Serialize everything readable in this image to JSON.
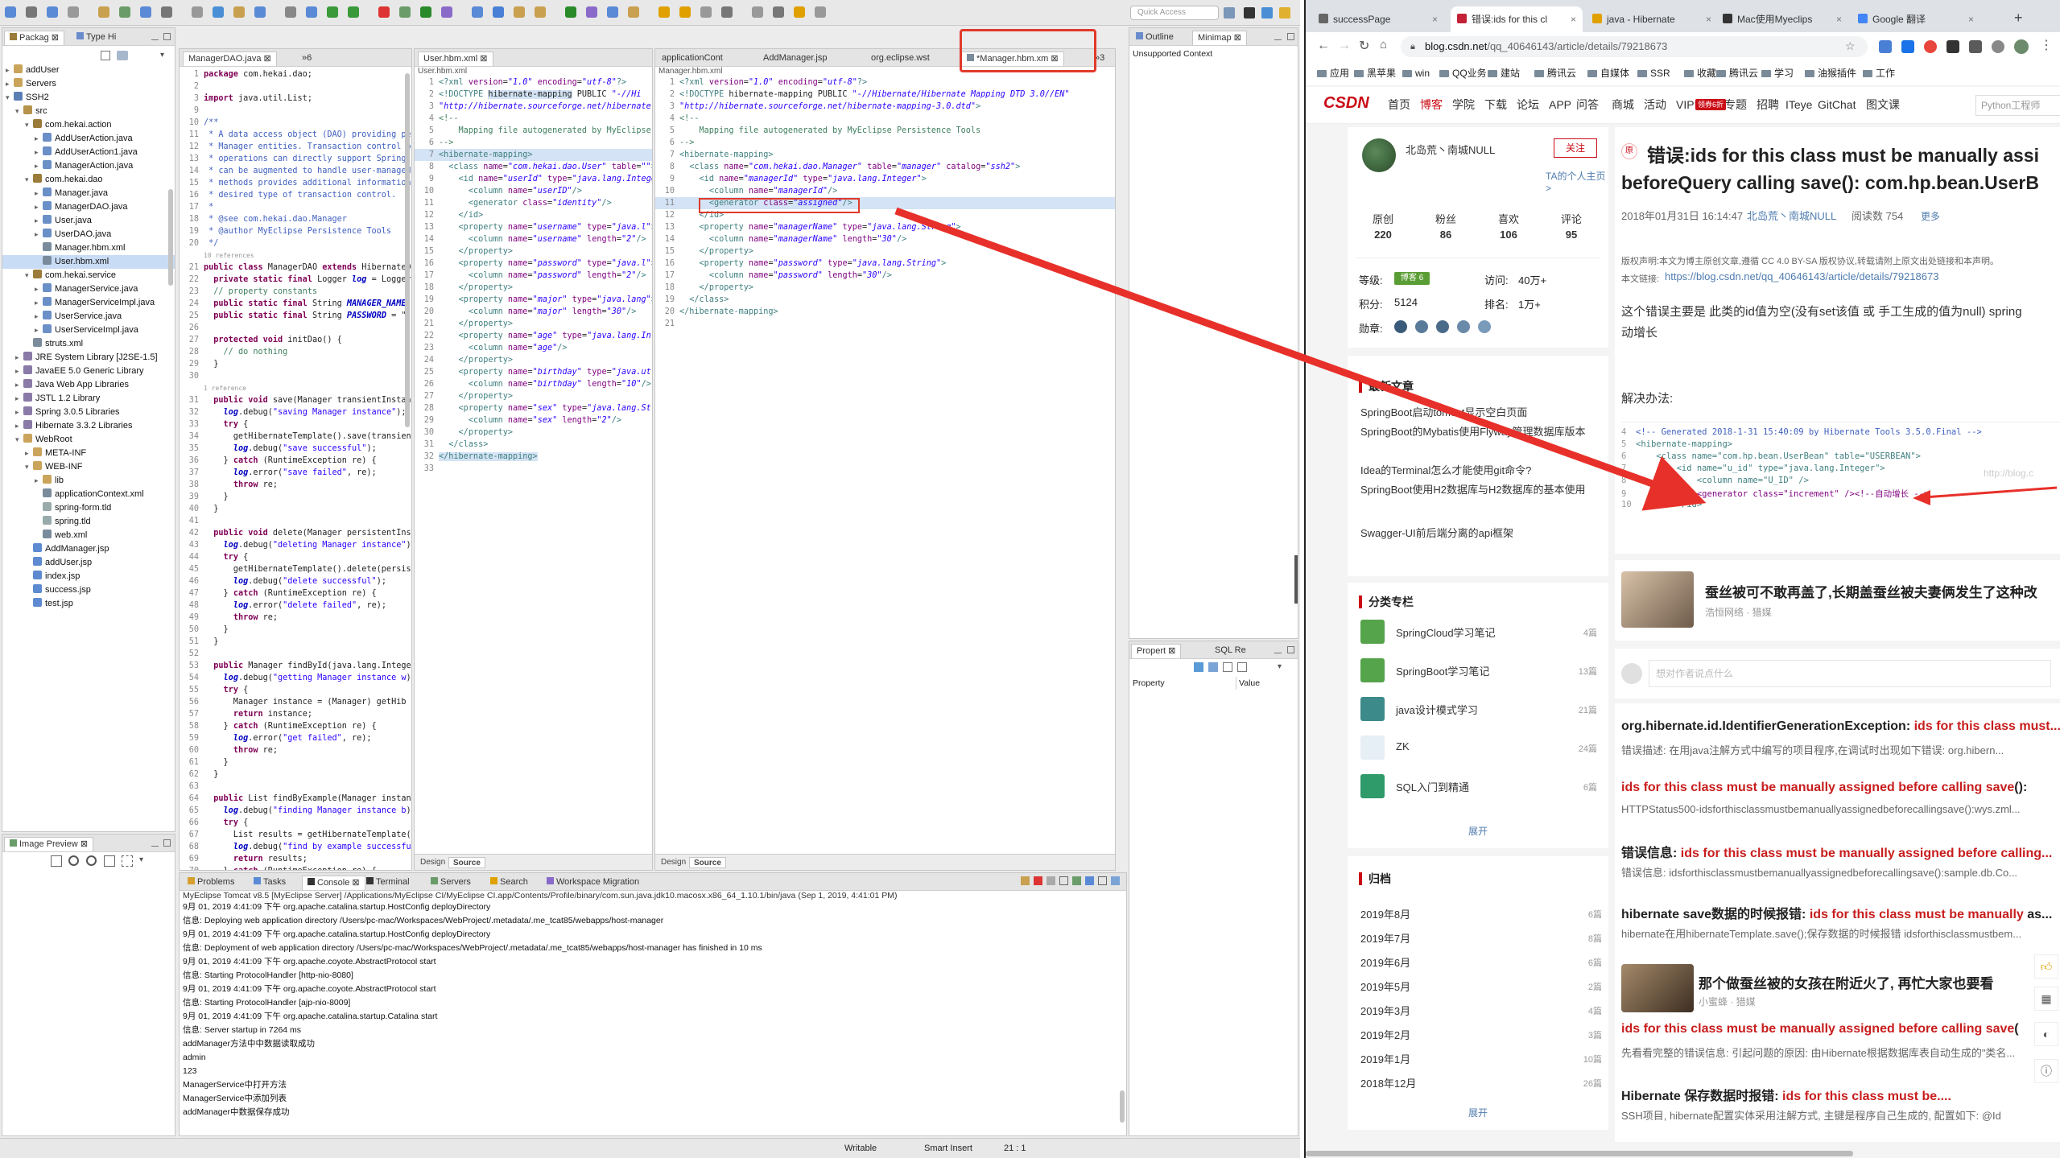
{
  "eclipse": {
    "toolbar": {
      "quick_access": "Quick Access"
    },
    "package_explorer": {
      "tabs": [
        "Packag",
        "Type Hi"
      ],
      "tree": [
        {
          "label": "addUser",
          "depth": 0,
          "tw": "▸",
          "icon": "folder",
          "color": "#caa45a"
        },
        {
          "label": "Servers",
          "depth": 0,
          "tw": "▸",
          "icon": "folder",
          "color": "#caa45a"
        },
        {
          "label": "SSH2",
          "depth": 0,
          "tw": "▾",
          "icon": "project",
          "color": "#5a7fb5"
        },
        {
          "label": "src",
          "depth": 1,
          "tw": "▾",
          "icon": "src",
          "color": "#b5934a"
        },
        {
          "label": "com.hekai.action",
          "depth": 2,
          "tw": "▾",
          "icon": "package",
          "color": "#9b7b3a"
        },
        {
          "label": "AddUserAction.java",
          "depth": 3,
          "tw": "▸",
          "icon": "java",
          "color": "#6b8fc7"
        },
        {
          "label": "AddUserAction1.java",
          "depth": 3,
          "tw": "▸",
          "icon": "java",
          "color": "#6b8fc7"
        },
        {
          "label": "ManagerAction.java",
          "depth": 3,
          "tw": "▸",
          "icon": "java",
          "color": "#6b8fc7"
        },
        {
          "label": "com.hekai.dao",
          "depth": 2,
          "tw": "▾",
          "icon": "package",
          "color": "#9b7b3a"
        },
        {
          "label": "Manager.java",
          "depth": 3,
          "tw": "▸",
          "icon": "java",
          "color": "#6b8fc7"
        },
        {
          "label": "ManagerDAO.java",
          "depth": 3,
          "tw": "▸",
          "icon": "java",
          "color": "#6b8fc7"
        },
        {
          "label": "User.java",
          "depth": 3,
          "tw": "▸",
          "icon": "java",
          "color": "#6b8fc7"
        },
        {
          "label": "UserDAO.java",
          "depth": 3,
          "tw": "▸",
          "icon": "java",
          "color": "#6b8fc7"
        },
        {
          "label": "Manager.hbm.xml",
          "depth": 3,
          "tw": "",
          "icon": "xml",
          "color": "#7a8b9c"
        },
        {
          "label": "User.hbm.xml",
          "depth": 3,
          "tw": "",
          "icon": "xml",
          "color": "#7a8b9c",
          "selected": true
        },
        {
          "label": "com.hekai.service",
          "depth": 2,
          "tw": "▾",
          "icon": "package",
          "color": "#9b7b3a"
        },
        {
          "label": "ManagerService.java",
          "depth": 3,
          "tw": "▸",
          "icon": "java",
          "color": "#6b8fc7"
        },
        {
          "label": "ManagerServiceImpl.java",
          "depth": 3,
          "tw": "▸",
          "icon": "java",
          "color": "#6b8fc7"
        },
        {
          "label": "UserService.java",
          "depth": 3,
          "tw": "▸",
          "icon": "java",
          "color": "#6b8fc7"
        },
        {
          "label": "UserServiceImpl.java",
          "depth": 3,
          "tw": "▸",
          "icon": "java",
          "color": "#6b8fc7"
        },
        {
          "label": "struts.xml",
          "depth": 2,
          "tw": "",
          "icon": "xml",
          "color": "#7a8b9c"
        },
        {
          "label": "JRE System Library [J2SE-1.5]",
          "depth": 1,
          "tw": "▸",
          "icon": "lib",
          "color": "#8a7aa8"
        },
        {
          "label": "JavaEE 5.0 Generic Library",
          "depth": 1,
          "tw": "▸",
          "icon": "lib",
          "color": "#8a7aa8"
        },
        {
          "label": "Java Web App Libraries",
          "depth": 1,
          "tw": "▸",
          "icon": "lib",
          "color": "#8a7aa8"
        },
        {
          "label": "JSTL 1.2 Library",
          "depth": 1,
          "tw": "▸",
          "icon": "lib",
          "color": "#8a7aa8"
        },
        {
          "label": "Spring 3.0.5 Libraries",
          "depth": 1,
          "tw": "▸",
          "icon": "lib",
          "color": "#8a7aa8"
        },
        {
          "label": "Hibernate 3.3.2 Libraries",
          "depth": 1,
          "tw": "▸",
          "icon": "lib",
          "color": "#8a7aa8"
        },
        {
          "label": "WebRoot",
          "depth": 1,
          "tw": "▾",
          "icon": "folder",
          "color": "#caa45a"
        },
        {
          "label": "META-INF",
          "depth": 2,
          "tw": "▸",
          "icon": "folder",
          "color": "#caa45a"
        },
        {
          "label": "WEB-INF",
          "depth": 2,
          "tw": "▾",
          "icon": "folder",
          "color": "#caa45a"
        },
        {
          "label": "lib",
          "depth": 3,
          "tw": "▸",
          "icon": "folder",
          "color": "#caa45a"
        },
        {
          "label": "applicationContext.xml",
          "depth": 3,
          "tw": "",
          "icon": "xml",
          "color": "#7a8b9c"
        },
        {
          "label": "spring-form.tld",
          "depth": 3,
          "tw": "",
          "icon": "file",
          "color": "#9aa"
        },
        {
          "label": "spring.tld",
          "depth": 3,
          "tw": "",
          "icon": "file",
          "color": "#9aa"
        },
        {
          "label": "web.xml",
          "depth": 3,
          "tw": "",
          "icon": "xml",
          "color": "#7a8b9c"
        },
        {
          "label": "AddManager.jsp",
          "depth": 2,
          "tw": "",
          "icon": "jsp",
          "color": "#5d8ad1"
        },
        {
          "label": "addUser.jsp",
          "depth": 2,
          "tw": "",
          "icon": "jsp",
          "color": "#5d8ad1"
        },
        {
          "label": "index.jsp",
          "depth": 2,
          "tw": "",
          "icon": "jsp",
          "color": "#5d8ad1"
        },
        {
          "label": "success.jsp",
          "depth": 2,
          "tw": "",
          "icon": "jsp",
          "color": "#5d8ad1"
        },
        {
          "label": "test.jsp",
          "depth": 2,
          "tw": "",
          "icon": "jsp",
          "color": "#5d8ad1"
        }
      ]
    },
    "image_preview": {
      "tab": "Image Preview"
    },
    "editor1": {
      "tab": "ManagerDAO.java",
      "overflow": "»6"
    },
    "editor2": {
      "tab": "User.hbm.xml",
      "crumb": "User.hbm.xml",
      "design": "Design",
      "source": "Source"
    },
    "editor3": {
      "tabs": [
        "applicationCont",
        "AddManager.jsp",
        "org.eclipse.wst",
        "*Manager.hbm.xm"
      ],
      "overflow": "»3",
      "crumb": "Manager.hbm.xml",
      "design": "Design",
      "source": "Source"
    },
    "outline": {
      "tabs": [
        "Outline",
        "Minimap"
      ],
      "text": "Unsupported Context"
    },
    "properties": {
      "tabs": [
        "Propert",
        "SQL Re"
      ],
      "col_property": "Property",
      "col_value": "Value"
    },
    "console": {
      "tabs": [
        "Problems",
        "Tasks",
        "Console",
        "Terminal",
        "Servers",
        "Search",
        "Workspace Migration"
      ],
      "header": "MyEclipse Tomcat v8.5 [MyEclipse Server] /Applications/MyEclipse CI/MyEclipse CI.app/Contents/Profile/binary/com.sun.java.jdk10.macosx.x86_64_1.10.1/bin/java (Sep 1, 2019, 4:41:01 PM)",
      "lines": [
        "9月 01, 2019 4:41:09 下午 org.apache.catalina.startup.HostConfig deployDirectory",
        "信息: Deploying web application directory /Users/pc-mac/Workspaces/WebProject/.metadata/.me_tcat85/webapps/host-manager",
        "9月 01, 2019 4:41:09 下午 org.apache.catalina.startup.HostConfig deployDirectory",
        "信息: Deployment of web application directory /Users/pc-mac/Workspaces/WebProject/.metadata/.me_tcat85/webapps/host-manager has finished in 10 ms",
        "9月 01, 2019 4:41:09 下午 org.apache.coyote.AbstractProtocol start",
        "信息: Starting ProtocolHandler [http-nio-8080]",
        "9月 01, 2019 4:41:09 下午 org.apache.coyote.AbstractProtocol start",
        "信息: Starting ProtocolHandler [ajp-nio-8009]",
        "9月 01, 2019 4:41:09 下午 org.apache.catalina.startup.Catalina start",
        "信息: Server startup in 7264 ms",
        "addManager方法中中数据读取成功",
        "admin",
        "123",
        "ManagerService中打开方法",
        "ManagerService中添加列表",
        "addManager中数据保存成功"
      ]
    },
    "status": {
      "writable": "Writable",
      "insert": "Smart Insert",
      "position": "21 : 1"
    }
  },
  "browser": {
    "tabs": [
      {
        "title": "successPage",
        "active": false,
        "color": "#666"
      },
      {
        "title": "错误:ids for this cl",
        "active": true,
        "color": "#c32136"
      },
      {
        "title": "java - Hibernate",
        "active": false,
        "color": "#e0a000"
      },
      {
        "title": "Mac使用Myeclips",
        "active": false,
        "color": "#333"
      },
      {
        "title": "Google 翻译",
        "active": false,
        "color": "#4285f4"
      }
    ],
    "url_host": "blog.csdn.net",
    "url_path": "/qq_40646143/article/details/79218673",
    "bookmarks": [
      "应用",
      "黑苹果",
      "win",
      "QQ业务",
      "建站",
      "腾讯云",
      "自媒体",
      "SSR",
      "收藏",
      "腾讯云",
      "学习",
      "油猴插件",
      "工作"
    ],
    "nav": {
      "logo": "CSDN",
      "items": [
        "首页",
        "博客",
        "学院",
        "下载",
        "论坛",
        "APP",
        "问答",
        "商城",
        "活动",
        "VIP会员",
        "专题",
        "招聘",
        "ITeye",
        "GitChat",
        "图文课"
      ],
      "vip_badge": "领券6折",
      "search_placeholder": "Python工程师"
    },
    "profile": {
      "name": "北岛荒丶南城NULL",
      "follow": "关注",
      "homepage": "TA的个人主页 >",
      "stats": [
        {
          "label": "原创",
          "value": "220"
        },
        {
          "label": "粉丝",
          "value": "86"
        },
        {
          "label": "喜欢",
          "value": "106"
        },
        {
          "label": "评论",
          "value": "95"
        }
      ],
      "level_label": "等级:",
      "level_badge": "博客 6",
      "visit_label": "访问:",
      "visit": "40万+",
      "points_label": "积分:",
      "points": "5124",
      "rank_label": "排名:",
      "rank": "1万+",
      "medals_label": "勋章:"
    },
    "latest": {
      "title": "最新文章",
      "items": [
        "SpringBoot启动tomcat显示空白页面",
        "SpringBoot的Mybatis使用Flyway管理数据库版本",
        "Idea的Terminal怎么才能使用git命令?",
        "SpringBoot使用H2数据库与H2数据库的基本使用",
        "Swagger-UI前后端分离的api框架"
      ]
    },
    "columns": {
      "title": "分类专栏",
      "items": [
        {
          "name": "SpringCloud学习笔记",
          "count": "4篇"
        },
        {
          "name": "SpringBoot学习笔记",
          "count": "13篇"
        },
        {
          "name": "java设计模式学习",
          "count": "21篇"
        },
        {
          "name": "ZK",
          "count": "24篇"
        },
        {
          "name": "SQL入门到精通",
          "count": "6篇"
        }
      ],
      "expand": "展开"
    },
    "archive": {
      "title": "归档",
      "items": [
        {
          "m": "2019年8月",
          "n": "6篇"
        },
        {
          "m": "2019年7月",
          "n": "8篇"
        },
        {
          "m": "2019年6月",
          "n": "6篇"
        },
        {
          "m": "2019年5月",
          "n": "2篇"
        },
        {
          "m": "2019年3月",
          "n": "4篇"
        },
        {
          "m": "2019年2月",
          "n": "3篇"
        },
        {
          "m": "2019年1月",
          "n": "10篇"
        },
        {
          "m": "2018年12月",
          "n": "26篇"
        }
      ],
      "expand": "展开"
    },
    "article": {
      "yuan": "原",
      "title1": "错误:ids for this class must be manually assi",
      "title2": "beforeQuery calling save(): com.hp.bean.UserB",
      "date": "2018年01月31日 16:14:47",
      "author": "北岛荒丶南城NULL",
      "reads": "阅读数 754",
      "more": "更多",
      "copyright": "版权声明:本文为博主原创文章,遵循 CC 4.0 BY-SA 版权协议,转载请附上原文出处链接和本声明。",
      "link_label": "本文链接:",
      "link": "https://blog.csdn.net/qq_40646143/article/details/79218673",
      "body1": "这个错误主要是 此类的id值为空(没有set该值 或 手工生成的值为null) spring",
      "body2": "动增长",
      "solution": "解决办法:",
      "snippet": [
        {
          "n": "4",
          "t": "<!-- Generated 2018-1-31 15:40:09 by Hibernate Tools 3.5.0.Final -->"
        },
        {
          "n": "5",
          "t": "<hibernate-mapping>"
        },
        {
          "n": "6",
          "t": "    <class name=\"com.hp.bean.UserBean\" table=\"USERBEAN\">"
        },
        {
          "n": "7",
          "t": "        <id name=\"u_id\" type=\"java.lang.Integer\">"
        },
        {
          "n": "8",
          "t": "            <column name=\"U_ID\" />"
        },
        {
          "n": "9",
          "t": "            <generator class=\"increment\" /><!--自动增长 -->"
        },
        {
          "n": "10",
          "t": "        </id>"
        }
      ],
      "watermark": "http://blog.c"
    },
    "ad1": {
      "title": "蚕丝被可不敢再盖了,长期盖蚕丝被夫妻俩发生了这种改",
      "source": "浩恒网络 · 猎媒"
    },
    "comment_placeholder": "想对作者说点什么",
    "results": [
      {
        "title": "org.hibernate.id.IdentifierGenerationException: ids for this class must...",
        "desc": "错误描述: 在用java注解方式中编写的项目程序,在调试时出现如下错误: org.hibern..."
      },
      {
        "title": "ids for this class must be manually assigned before calling save():",
        "desc": "HTTPStatus500-idsforthisclassmustbemanuallyassignedbeforecallingsave():wys.zml..."
      },
      {
        "title": "错误信息: ids for this class must be manually assigned before calling...",
        "desc": "错误信息: idsforthisclassmustbemanuallyassignedbeforecallingsave():sample.db.Co..."
      },
      {
        "title": "hibernate save数据的时候报错: ids for this class must be manually as...",
        "desc": "hibernate在用hibernateTemplate.save();保存数据的时候报错 idsforthisclassmustbem..."
      }
    ],
    "ad2": {
      "title": "那个做蚕丝被的女孩在附近火了, 再忙大家也要看",
      "source": "小蜜蜂 · 猎媒"
    },
    "results2": [
      {
        "title": "ids for this class must be manually assigned before calling save(",
        "desc": "先看看完整的错误信息: 引起问题的原因: 由Hibernate根据数据库表自动生成的\"类名..."
      },
      {
        "title": "Hibernate 保存数据时报错: ids for this class must be....",
        "desc": "SSH项目, hibernate配置实体采用注解方式, 主键是程序自己生成的, 配置如下: @Id"
      }
    ]
  }
}
